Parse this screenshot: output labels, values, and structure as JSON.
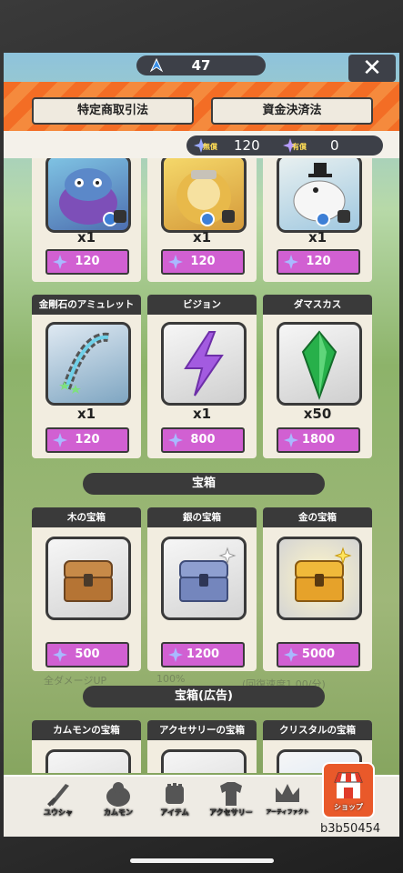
{
  "topbar": {
    "gem_count": "47",
    "close_label": "✕"
  },
  "law_buttons": {
    "left": "特定商取引法",
    "right": "資金決済法"
  },
  "currency": {
    "paid_tag": "無償",
    "paid_value": "120",
    "free_tag": "有償",
    "free_value": "0"
  },
  "top_row": [
    {
      "qty": "x1",
      "price": "120"
    },
    {
      "qty": "x1",
      "price": "120"
    },
    {
      "qty": "x1",
      "price": "120"
    }
  ],
  "items_row": [
    {
      "name": "金剛石のアミュレット",
      "qty": "x1",
      "price": "120"
    },
    {
      "name": "ビジョン",
      "qty": "x1",
      "price": "800"
    },
    {
      "name": "ダマスカス",
      "qty": "x50",
      "price": "1800"
    }
  ],
  "treasure_section": {
    "title": "宝箱"
  },
  "treasure_row": [
    {
      "name": "木の宝箱",
      "price": "500"
    },
    {
      "name": "銀の宝箱",
      "price": "1200"
    },
    {
      "name": "金の宝箱",
      "price": "5000"
    }
  ],
  "ad_section": {
    "title": "宝箱(広告)"
  },
  "ad_row": [
    {
      "name": "カムモンの宝箱"
    },
    {
      "name": "アクセサリーの宝箱"
    },
    {
      "name": "クリスタルの宝箱"
    }
  ],
  "background_text": {
    "left": "全ダメージUP",
    "mid": "100%",
    "right": "(回復速度1.00/分)"
  },
  "nav": {
    "units": "ユウシャ",
    "kammon": "カムモン",
    "items": "アイテム",
    "accessory": "アクセサリー",
    "artifact": "アーティファクト",
    "shop": "ショップ"
  },
  "user_id": "b3b50454",
  "colors": {
    "price_bg": "#d160d2",
    "header_orange": "#f36d25",
    "dark": "#3a3a3a"
  }
}
